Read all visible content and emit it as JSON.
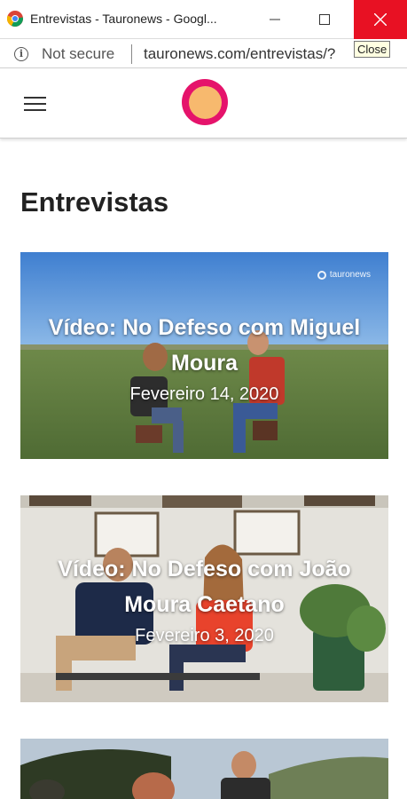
{
  "window": {
    "title": "Entrevistas - Tauronews - Googl...",
    "close_tooltip": "Close"
  },
  "address_bar": {
    "security_label": "Not secure",
    "url": "tauronews.com/entrevistas/?"
  },
  "site": {
    "logo_colors": {
      "ring": "#e5136b",
      "inner": "#f7b96e"
    }
  },
  "page": {
    "title": "Entrevistas",
    "articles": [
      {
        "title": "Vídeo: No Defeso com Miguel Moura",
        "date": "Fevereiro 14, 2020",
        "watermark": "tauronews"
      },
      {
        "title": "Vídeo: No Defeso com João Moura Caetano",
        "date": "Fevereiro 3, 2020"
      },
      {
        "title": "",
        "date": ""
      }
    ]
  }
}
